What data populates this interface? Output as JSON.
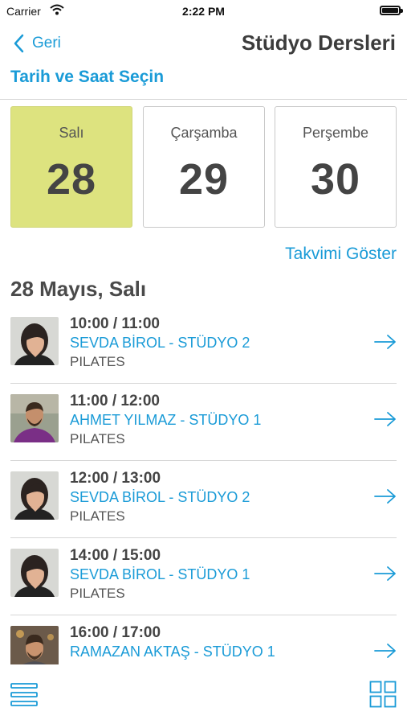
{
  "status_bar": {
    "carrier": "Carrier",
    "time": "2:22 PM"
  },
  "nav": {
    "back_label": "Geri",
    "title": "Stüdyo Dersleri"
  },
  "section_heading": "Tarih ve Saat Seçin",
  "days": [
    {
      "name": "Salı",
      "number": "28",
      "selected": true
    },
    {
      "name": "Çarşamba",
      "number": "29",
      "selected": false
    },
    {
      "name": "Perşembe",
      "number": "30",
      "selected": false
    }
  ],
  "show_calendar_label": "Takvimi Göster",
  "date_heading": "28 Mayıs, Salı",
  "sessions": [
    {
      "time": "10:00 / 11:00",
      "instructor": "SEVDA BİROL - STÜDYO 2",
      "class": "PILATES"
    },
    {
      "time": "11:00 / 12:00",
      "instructor": "AHMET YILMAZ - STÜDYO 1",
      "class": "PILATES"
    },
    {
      "time": "12:00 / 13:00",
      "instructor": "SEVDA BİROL - STÜDYO 2",
      "class": "PILATES"
    },
    {
      "time": "14:00 / 15:00",
      "instructor": "SEVDA BİROL - STÜDYO 1",
      "class": "PILATES"
    },
    {
      "time": "16:00 / 17:00",
      "instructor": "RAMAZAN AKTAŞ - STÜDYO 1",
      "class": ""
    }
  ],
  "colors": {
    "accent": "#1a9bd7",
    "selected_day": "#dde37f",
    "text_dark": "#444444",
    "divider": "#d6d6d6"
  },
  "icons": {
    "back": "chevron-left-icon",
    "row_action": "arrow-right-icon",
    "list_view": "list-view-icon",
    "grid_view": "grid-view-icon"
  }
}
